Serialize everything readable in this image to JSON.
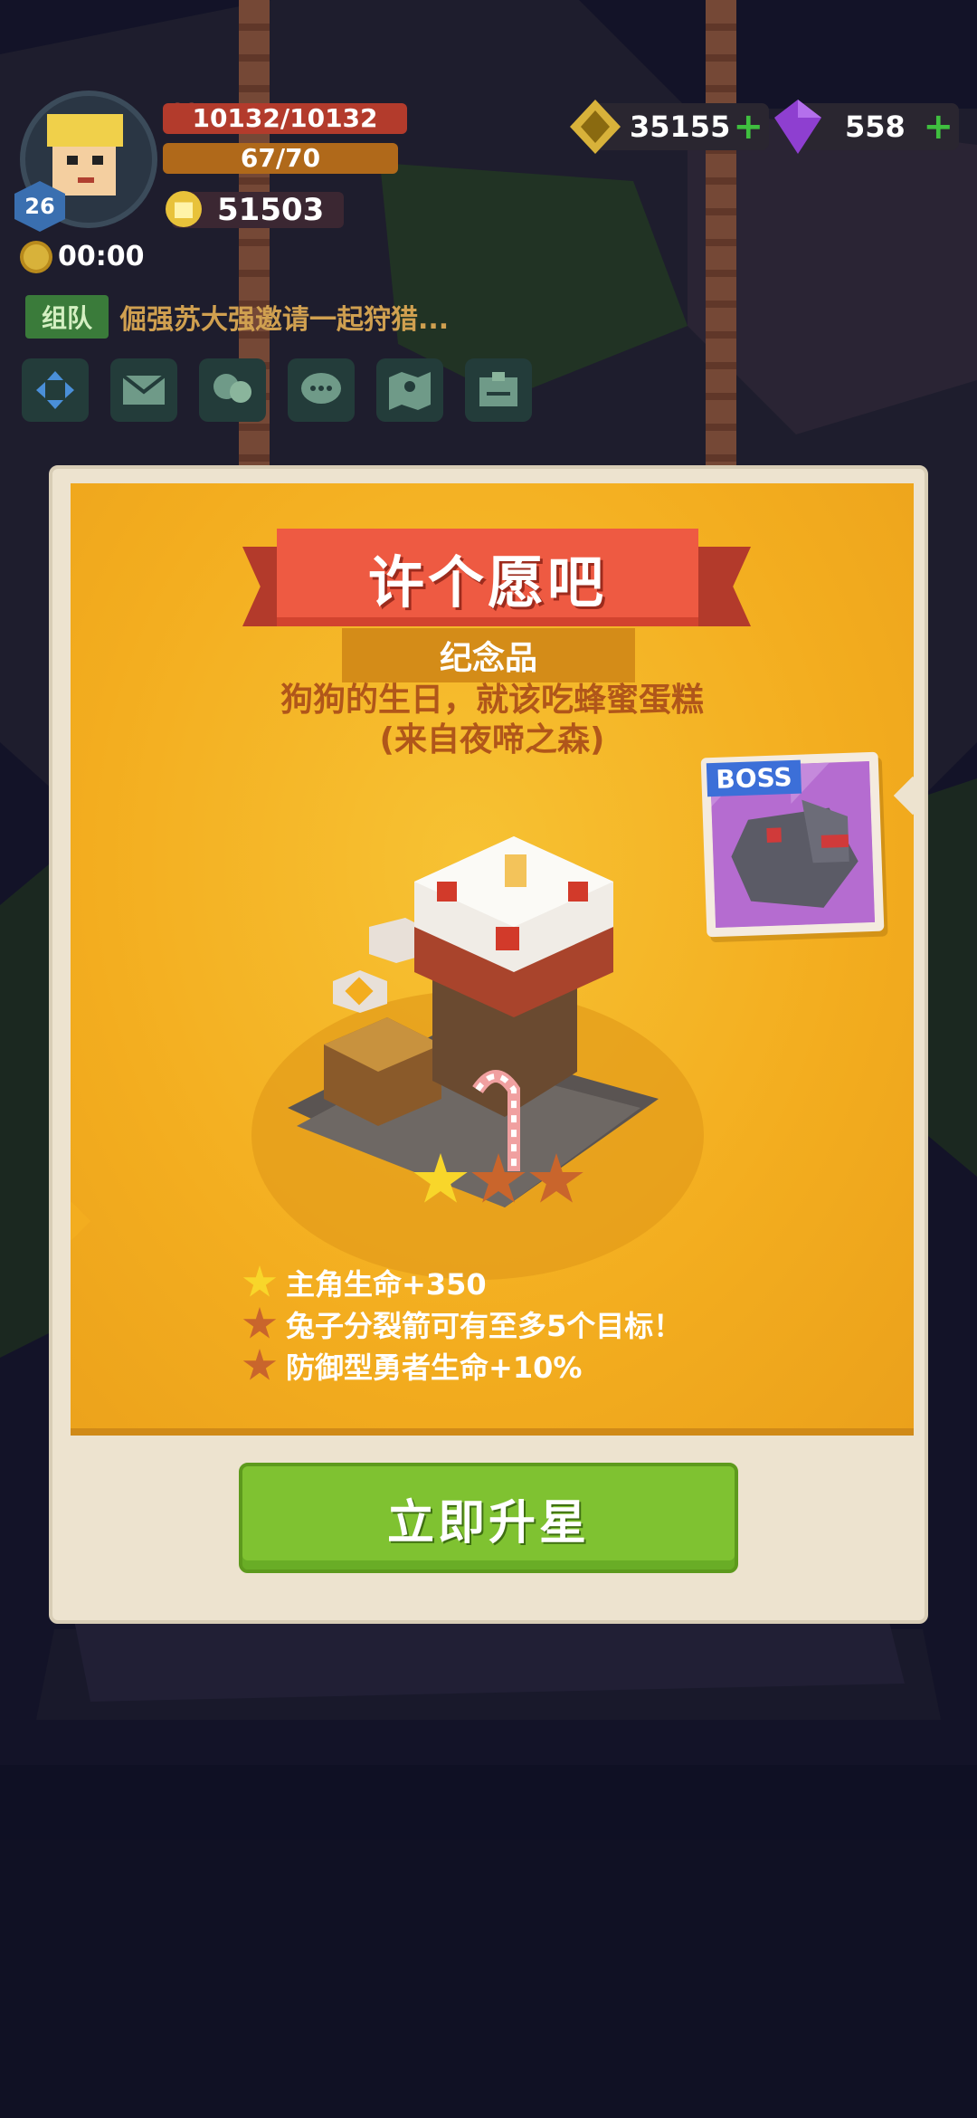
{
  "hud": {
    "level": "26",
    "hp_text": "10132/10132",
    "energy_text": "67/70",
    "power_text": "51503",
    "timer": "00:00",
    "gold": "35155",
    "gems": "558",
    "chat_tag": "组队",
    "chat_message": "倔强苏大强邀请一起狩猎..."
  },
  "modal": {
    "title": "许个愿吧",
    "subtitle": "纪念品",
    "description_line1": "狗狗的生日，就该吃蜂蜜蛋糕",
    "description_line2": "(来自夜啼之森)",
    "boss_label": "BOSS",
    "stars": {
      "filled": 1,
      "total": 3
    },
    "bonuses": [
      {
        "text": "主角生命+350",
        "star": "gold"
      },
      {
        "text": "兔子分裂箭可有至多5个目标！",
        "star": "bronze"
      },
      {
        "text": "防御型勇者生命+10%",
        "star": "bronze"
      }
    ],
    "action_button": "立即升星"
  },
  "colors": {
    "panel": "#f3ad1f",
    "ribbon": "#ee5a42",
    "button": "#7fc231",
    "star_on": "#f8d62a",
    "star_off": "#c9652c"
  }
}
